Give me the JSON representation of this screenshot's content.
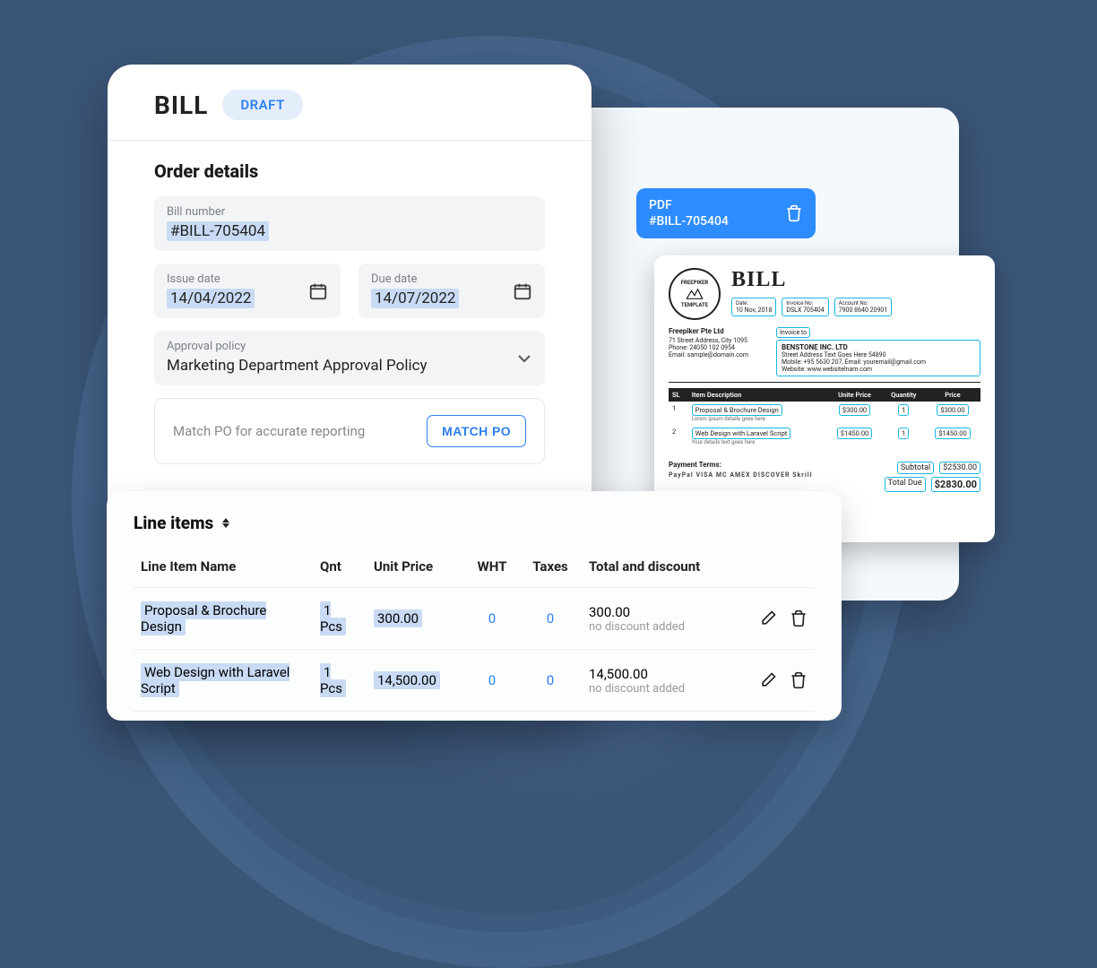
{
  "header": {
    "title": "BILL",
    "badge": "DRAFT"
  },
  "order_details": {
    "heading": "Order details",
    "bill_number_label": "Bill number",
    "bill_number_value": "#BILL-705404",
    "issue_date_label": "Issue date",
    "issue_date_value": "14/04/2022",
    "due_date_label": "Due date",
    "due_date_value": "14/07/2022",
    "approval_label": "Approval policy",
    "approval_value": "Marketing Department Approval Policy",
    "match_po_text": "Match PO for accurate reporting",
    "match_po_button": "MATCH PO"
  },
  "pdf": {
    "line1": "PDF",
    "line2": "#BILL-705404"
  },
  "invoice_preview": {
    "brand_top": "FREEPIKER",
    "brand_bottom": "TEMPLATE",
    "title": "BILL",
    "date_label": "Date:",
    "date_value": "10 Nov, 2018",
    "invoice_no_label": "Invoice No:",
    "invoice_no_value": "DSLX 705404",
    "account_no_label": "Account No:",
    "account_no_value": "7900 8640 20901",
    "from_name": "Freepiker Pte Ltd",
    "from_addr1": "71 Street Address, City 1095",
    "from_addr2": "Phone: 24050 102 0954",
    "from_addr3": "Email: sample@domain.com",
    "invoice_to_label": "Invoice to",
    "to_name": "BENSTONE INC. LTD",
    "to_addr1": "Street Address Text Goes Here 54890",
    "to_addr2": "Mobile: +95 5630 207, Email: youremail@gmail.com",
    "to_addr3": "Website: www.websitelnam.com",
    "columns": {
      "c1": "SL",
      "c2": "Item Description",
      "c3": "Unite Price",
      "c4": "Quantity",
      "c5": "Price"
    },
    "rows": [
      {
        "sl": "1",
        "desc": "Proposal & Brochure Design",
        "sub": "Lorem ipsum details goes here",
        "unit": "$300.00",
        "qty": "1",
        "price": "$300.00"
      },
      {
        "sl": "2",
        "desc": "Web Design with Laravel Script",
        "sub": "Your details text goes here",
        "unit": "$1450.00",
        "qty": "1",
        "price": "$1450.00"
      }
    ],
    "subtotal_label": "Subtotal",
    "subtotal_value": "$2530.00",
    "total_due_label": "Total Due",
    "total_due_value": "$2830.00",
    "payment_terms": "Payment Terms:",
    "pay_methods": "PayPal  VISA  MC  AMEX  DISCOVER  Skrill"
  },
  "line_items": {
    "heading": "Line items",
    "columns": {
      "name": "Line Item Name",
      "qnt": "Qnt",
      "unit": "Unit Price",
      "wht": "WHT",
      "taxes": "Taxes",
      "total": "Total and discount"
    },
    "rows": [
      {
        "name": "Proposal & Brochure Design",
        "qnt": "1 Pcs",
        "unit": "300.00",
        "wht": "0",
        "taxes": "0",
        "total": "300.00",
        "discount_note": "no discount added"
      },
      {
        "name": "Web Design with Laravel Script",
        "qnt": "1 Pcs",
        "unit": "14,500.00",
        "wht": "0",
        "taxes": "0",
        "total": "14,500.00",
        "discount_note": "no discount added"
      }
    ]
  }
}
